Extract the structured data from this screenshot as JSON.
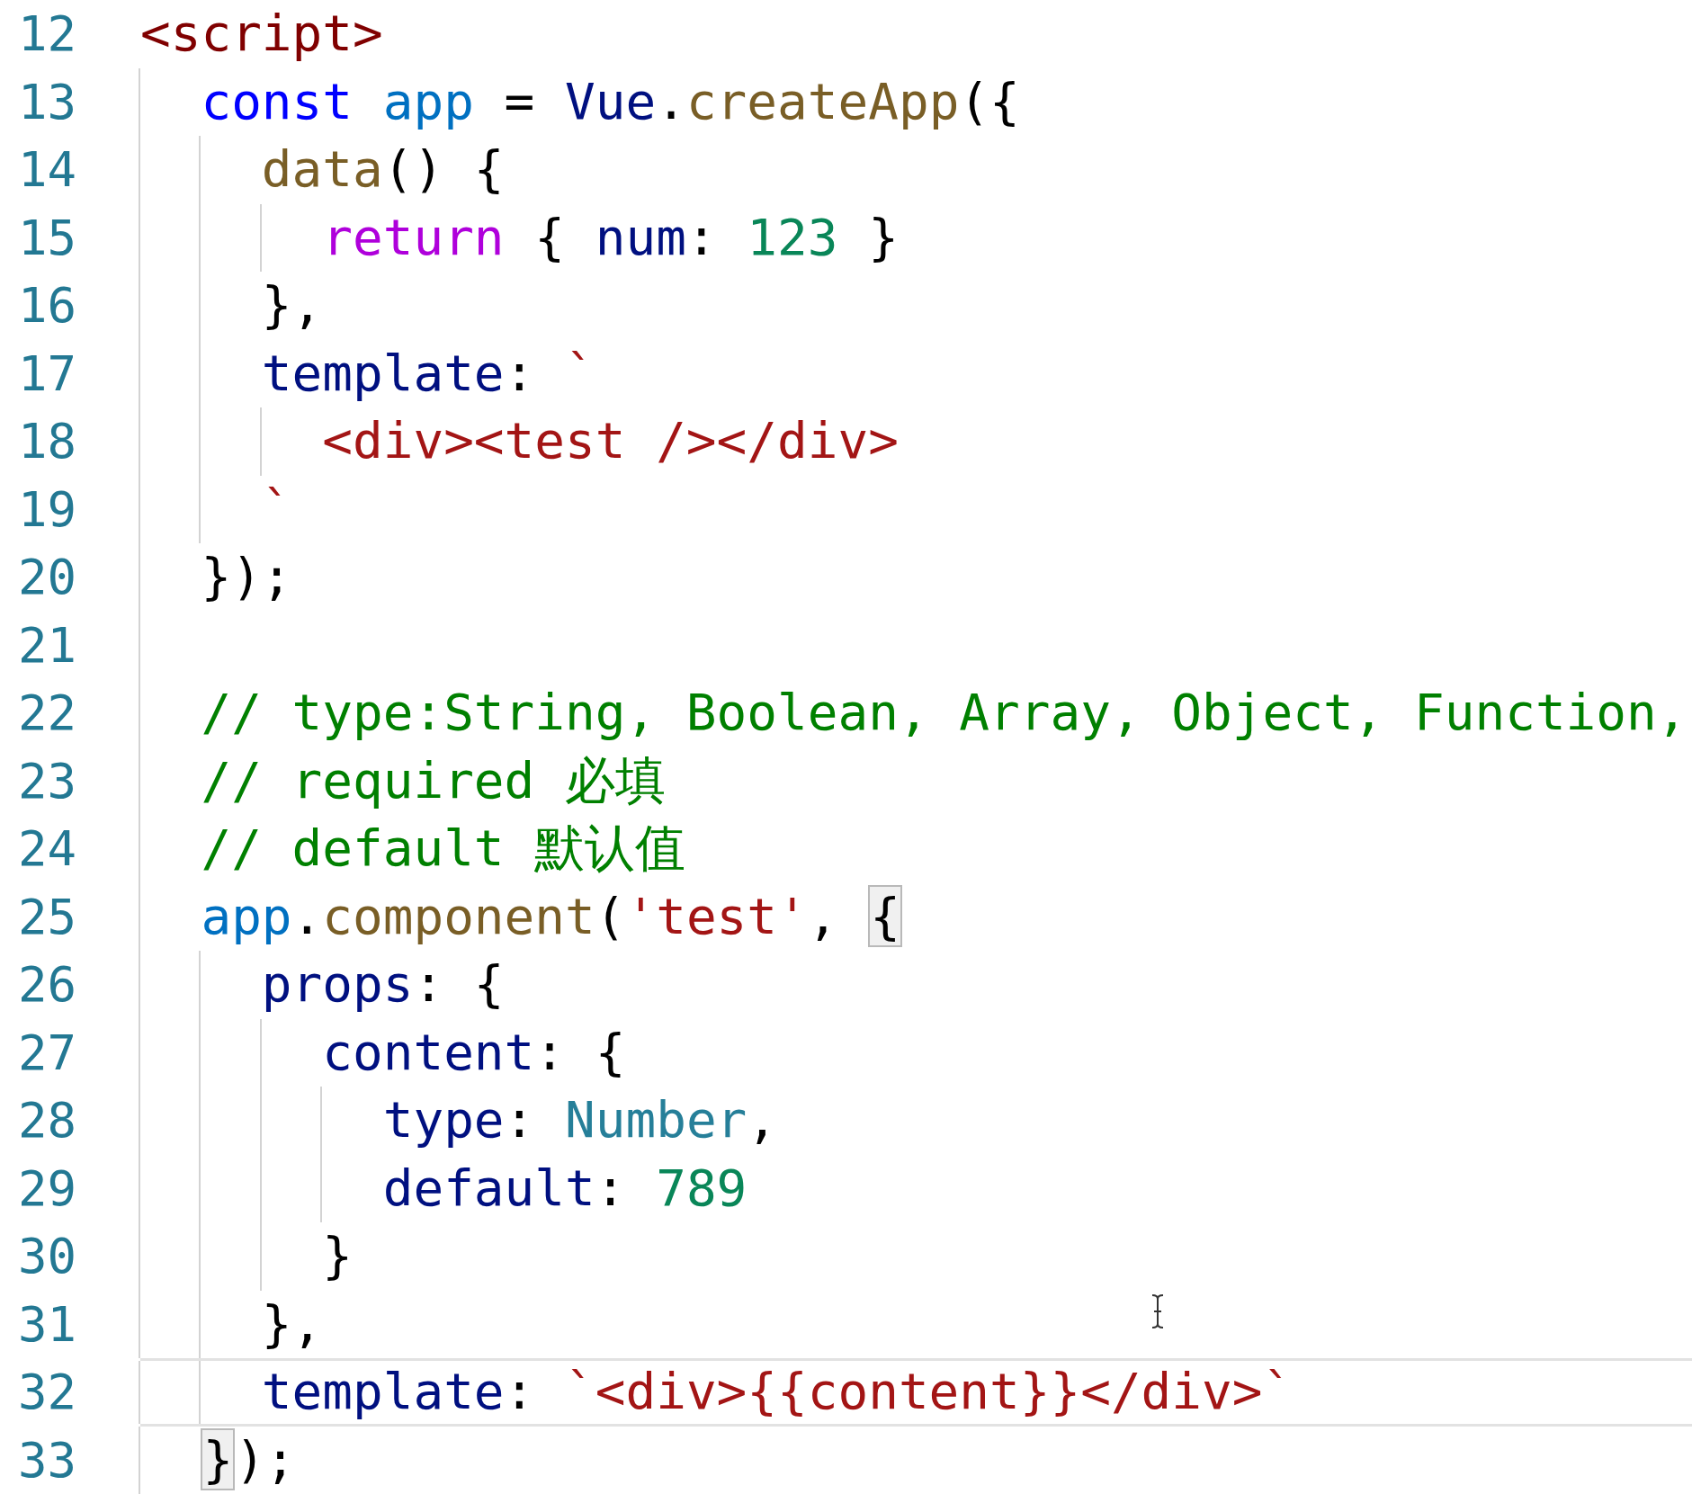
{
  "editor": {
    "lines": [
      {
        "number": "12",
        "current": false,
        "tokens": [
          {
            "text": "<script>",
            "kind": "tag"
          }
        ]
      },
      {
        "number": "13",
        "current": false,
        "tokens": [
          {
            "text": "  const",
            "kind": "keyword"
          },
          {
            "text": " app",
            "kind": "const"
          },
          {
            "text": " = ",
            "kind": "plain"
          },
          {
            "text": "Vue",
            "kind": "variable"
          },
          {
            "text": ".",
            "kind": "plain"
          },
          {
            "text": "createApp",
            "kind": "function"
          },
          {
            "text": "({",
            "kind": "plain"
          }
        ]
      },
      {
        "number": "14",
        "current": false,
        "tokens": [
          {
            "text": "    data",
            "kind": "function"
          },
          {
            "text": "() {",
            "kind": "plain"
          }
        ]
      },
      {
        "number": "15",
        "current": false,
        "tokens": [
          {
            "text": "      return",
            "kind": "control"
          },
          {
            "text": " { ",
            "kind": "plain"
          },
          {
            "text": "num",
            "kind": "variable"
          },
          {
            "text": ": ",
            "kind": "plain"
          },
          {
            "text": "123",
            "kind": "number"
          },
          {
            "text": " }",
            "kind": "plain"
          }
        ]
      },
      {
        "number": "16",
        "current": false,
        "tokens": [
          {
            "text": "    },",
            "kind": "plain"
          }
        ]
      },
      {
        "number": "17",
        "current": false,
        "tokens": [
          {
            "text": "    template",
            "kind": "variable"
          },
          {
            "text": ": ",
            "kind": "plain"
          },
          {
            "text": "`",
            "kind": "string"
          }
        ]
      },
      {
        "number": "18",
        "current": false,
        "tokens": [
          {
            "text": "      <div><test /></div>",
            "kind": "string"
          }
        ]
      },
      {
        "number": "19",
        "current": false,
        "tokens": [
          {
            "text": "    `",
            "kind": "string"
          }
        ]
      },
      {
        "number": "20",
        "current": false,
        "tokens": [
          {
            "text": "  });",
            "kind": "plain"
          }
        ]
      },
      {
        "number": "21",
        "current": false
      },
      {
        "number": "22",
        "current": false,
        "tokens": [
          {
            "text": "  // type:String, Boolean, Array, Object, Function,",
            "kind": "comment"
          }
        ]
      },
      {
        "number": "23",
        "current": false,
        "tokens": [
          {
            "text": "  // required 必填",
            "kind": "comment"
          }
        ]
      },
      {
        "number": "24",
        "current": false,
        "tokens": [
          {
            "text": "  // default 默认值",
            "kind": "comment"
          }
        ]
      },
      {
        "number": "25",
        "current": false,
        "tokens": [
          {
            "text": "  app",
            "kind": "const"
          },
          {
            "text": ".",
            "kind": "plain"
          },
          {
            "text": "component",
            "kind": "function"
          },
          {
            "text": "(",
            "kind": "plain"
          },
          {
            "text": "'test'",
            "kind": "string"
          },
          {
            "text": ", ",
            "kind": "plain"
          },
          {
            "text": "{",
            "kind": "plain",
            "matched": true
          }
        ]
      },
      {
        "number": "26",
        "current": false,
        "tokens": [
          {
            "text": "    props",
            "kind": "variable"
          },
          {
            "text": ": {",
            "kind": "plain"
          }
        ]
      },
      {
        "number": "27",
        "current": false,
        "tokens": [
          {
            "text": "      content",
            "kind": "variable"
          },
          {
            "text": ": {",
            "kind": "plain"
          }
        ]
      },
      {
        "number": "28",
        "current": false,
        "tokens": [
          {
            "text": "        type",
            "kind": "variable"
          },
          {
            "text": ": ",
            "kind": "plain"
          },
          {
            "text": "Number",
            "kind": "type"
          },
          {
            "text": ",",
            "kind": "plain"
          }
        ]
      },
      {
        "number": "29",
        "current": false,
        "tokens": [
          {
            "text": "        default",
            "kind": "variable"
          },
          {
            "text": ": ",
            "kind": "plain"
          },
          {
            "text": "789",
            "kind": "number"
          }
        ]
      },
      {
        "number": "30",
        "current": false,
        "tokens": [
          {
            "text": "      }",
            "kind": "plain"
          }
        ]
      },
      {
        "number": "31",
        "current": false,
        "tokens": [
          {
            "text": "    },",
            "kind": "plain"
          }
        ]
      },
      {
        "number": "32",
        "current": true,
        "tokens": [
          {
            "text": "    template",
            "kind": "variable"
          },
          {
            "text": ": ",
            "kind": "plain"
          },
          {
            "text": "`<div>{{content}}</div>`",
            "kind": "string"
          }
        ]
      },
      {
        "number": "33",
        "current": false,
        "tokens": [
          {
            "text": "  }",
            "kind": "plain",
            "matched": true
          },
          {
            "text": ");",
            "kind": "plain"
          }
        ]
      }
    ]
  }
}
